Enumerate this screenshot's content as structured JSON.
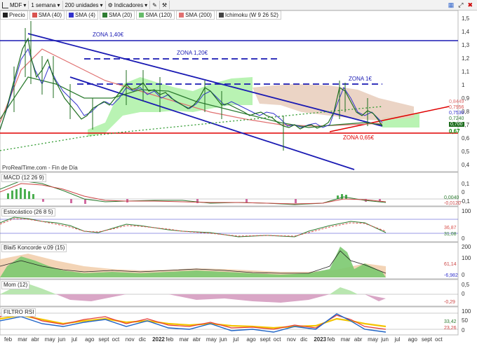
{
  "toolbar": {
    "symbol": "MDF",
    "timeframe": "1 semana",
    "units": "200 unidades",
    "indicators": "Indicadores"
  },
  "legend": [
    {
      "label": "Precio",
      "color": "#222222"
    },
    {
      "label": "SMA (40)",
      "color": "#d9534f"
    },
    {
      "label": "SMA (4)",
      "color": "#3333cc"
    },
    {
      "label": "SMA (20)",
      "color": "#2e7d32"
    },
    {
      "label": "SMA (120)",
      "color": "#66bb6a"
    },
    {
      "label": "SMA (200)",
      "color": "#e07070"
    },
    {
      "label": "Ichimoku (W 9 26 52)",
      "color": "#444444"
    }
  ],
  "annotations": {
    "zona140": "ZONA 1,40€",
    "zona120": "ZONA 1,20€",
    "zona1": "ZONA 1€",
    "zona065": "ZONA 0,65€",
    "source": "ProRealTime.com - Fin de Día"
  },
  "price_axis": [
    "1,5",
    "1,4",
    "1,3",
    "1,2",
    "1,1",
    "1",
    "0,9",
    "0,8",
    "0,7",
    "0,6",
    "0,5",
    "0,4"
  ],
  "price_badges": [
    "0,8449",
    "0,7956",
    "0,7530",
    "0,7240",
    "0,700",
    "0,67"
  ],
  "panels": {
    "macd": {
      "title": "MACD (12 26 9)",
      "axis": [
        "0,1",
        "0",
        "-0,1"
      ],
      "badges": [
        "0,0040",
        "-0,0120"
      ]
    },
    "stoch": {
      "title": "Estocástico (26 8 5)",
      "axis": [
        "100",
        "0"
      ],
      "badges": [
        "36,87",
        "31,08"
      ]
    },
    "koncorde": {
      "title": "Blai5 Koncorde v.09 (15)",
      "axis": [
        "200",
        "100",
        "0"
      ],
      "badges": [
        "61,14",
        "-6,982"
      ]
    },
    "mom": {
      "title": "Mom (12)",
      "axis": [
        "0,5",
        "0"
      ],
      "badges": [
        "-0,29"
      ]
    },
    "rsi": {
      "title": "FILTRO RSI",
      "axis": [
        "100",
        "50",
        "0"
      ],
      "badges": [
        "33,42",
        "23,26"
      ]
    }
  },
  "x_axis": [
    "feb",
    "mar",
    "abr",
    "may",
    "jun",
    "jul",
    "ago",
    "sept",
    "oct",
    "nov",
    "dic",
    "2022",
    "feb",
    "mar",
    "abr",
    "may",
    "jun",
    "jul",
    "ago",
    "sept",
    "oct",
    "nov",
    "dic",
    "2023",
    "feb",
    "mar",
    "abr",
    "may",
    "jun",
    "jul",
    "ago",
    "sept",
    "oct"
  ],
  "colors": {
    "accent_blue": "#1a1ab3",
    "support_red": "#e00000",
    "cloud_green": "#a7f0a0",
    "cloud_tan": "#e8cdbb"
  }
}
